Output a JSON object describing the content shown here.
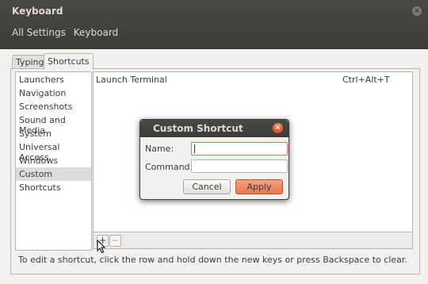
{
  "window": {
    "title": "Keyboard",
    "close_glyph": "×"
  },
  "nav": {
    "all_settings": "All Settings",
    "current": "Keyboard"
  },
  "tabs": [
    {
      "label": "Typing",
      "selected": false
    },
    {
      "label": "Shortcuts",
      "selected": true
    }
  ],
  "categories": [
    {
      "label": "Launchers",
      "selected": false
    },
    {
      "label": "Navigation",
      "selected": false
    },
    {
      "label": "Screenshots",
      "selected": false
    },
    {
      "label": "Sound and Media",
      "selected": false
    },
    {
      "label": "System",
      "selected": false
    },
    {
      "label": "Universal Access",
      "selected": false
    },
    {
      "label": "Windows",
      "selected": false
    },
    {
      "label": "Custom Shortcuts",
      "selected": true
    }
  ],
  "shortcuts": [
    {
      "name": "Launch Terminal",
      "keys": "Ctrl+Alt+T"
    }
  ],
  "toolbar": {
    "add_label": "+",
    "remove_label": "−"
  },
  "hint": "To edit a shortcut, click the row and hold down the new keys or press Backspace to clear.",
  "dialog": {
    "title": "Custom Shortcut",
    "close_glyph": "×",
    "name_label": "Name:",
    "name_value": "",
    "command_label": "Command:",
    "command_value": "",
    "cancel_label": "Cancel",
    "apply_label": "Apply"
  },
  "colors": {
    "titlebar": "#3c3b37",
    "accent": "#e9784f",
    "selection": "#dedcda"
  }
}
